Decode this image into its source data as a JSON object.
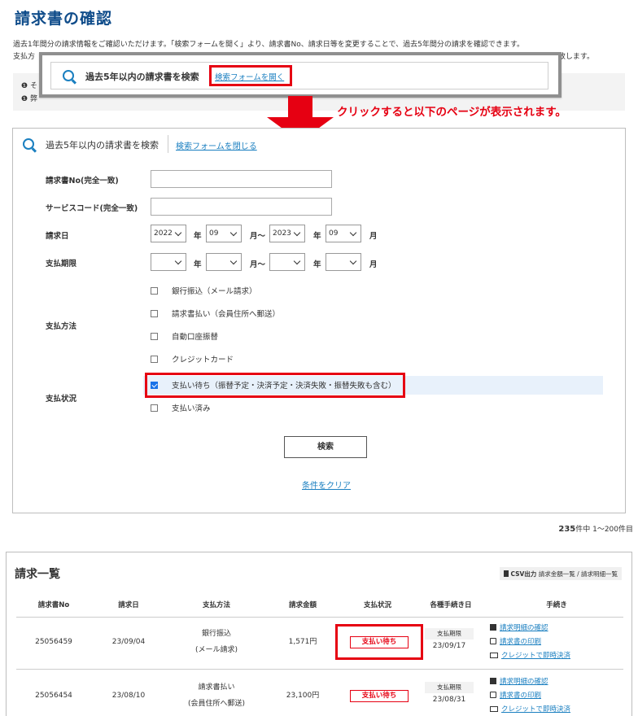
{
  "page": {
    "title": "請求書の確認",
    "intro_line1": "過去1年間分の請求情報をご確認いただけます。「検索フォームを開く」より、請求書No、請求日等を変更することで、過去5年間分の請求を確認できます。",
    "intro_line2_head": "支払方",
    "intro_line2_tail": "致します。",
    "notice_1": "そ",
    "notice_2": "弊"
  },
  "callout": {
    "title": "過去5年以内の請求書を検索",
    "open_link": "検索フォームを開く",
    "note": "クリックすると以下のページが表示されます。"
  },
  "search_form": {
    "title": "過去5年以内の請求書を検索",
    "close_link": "検索フォームを閉じる",
    "invoice_no_label": "請求書No(完全一致)",
    "service_code_label": "サービスコード(完全一致)",
    "billing_date_label": "請求日",
    "billing_date": {
      "from_year": "2022",
      "from_month": "09",
      "to_year": "2023",
      "to_month": "09"
    },
    "due_date_label": "支払期限",
    "due_date": {
      "from_year": "",
      "from_month": "",
      "to_year": "",
      "to_month": ""
    },
    "unit_year": "年",
    "unit_month_range": "月〜",
    "unit_month": "月",
    "payment_method_label": "支払方法",
    "payment_methods": [
      {
        "label": "銀行振込（メール請求）",
        "checked": false
      },
      {
        "label": "請求書払い（会員住所へ郵送）",
        "checked": false
      },
      {
        "label": "自動口座振替",
        "checked": false
      },
      {
        "label": "クレジットカード",
        "checked": false
      }
    ],
    "payment_status_label": "支払状況",
    "payment_statuses": [
      {
        "label": "支払い待ち（振替予定・決済予定・決済失敗・振替失敗も含む）",
        "checked": true
      },
      {
        "label": "支払い済み",
        "checked": false
      }
    ],
    "search_button": "検索",
    "clear_link": "条件をクリア"
  },
  "results": {
    "total": "235",
    "total_suffix": "件中 1〜200件目"
  },
  "invoice_list": {
    "title": "請求一覧",
    "csv_label": "CSV出力",
    "csv_links": "請求金額一覧 / 請求明細一覧",
    "columns": [
      "請求書No",
      "請求日",
      "支払方法",
      "請求金額",
      "支払状況",
      "各種手続き日",
      "手続き"
    ],
    "rows": [
      {
        "invoice_no": "25056459",
        "billing_date": "23/09/04",
        "method_line1": "銀行振込",
        "method_line2": "(メール請求)",
        "amount": "1,571円",
        "status": "支払い待ち",
        "due_label": "支払期限",
        "due_date": "23/09/17",
        "actions": [
          "請求明細の確認",
          "請求書の印刷",
          "クレジットで即時決済"
        ]
      },
      {
        "invoice_no": "25056454",
        "billing_date": "23/08/10",
        "method_line1": "請求書払い",
        "method_line2": "(会員住所へ郵送)",
        "amount": "23,100円",
        "status": "支払い待ち",
        "due_label": "支払期限",
        "due_date": "23/08/31",
        "actions": [
          "請求明細の確認",
          "請求書の印刷",
          "クレジットで即時決済"
        ]
      }
    ]
  },
  "colors": {
    "accent_red": "#e60012",
    "link_blue": "#1a7fc0",
    "title_blue": "#0f4c8a"
  }
}
